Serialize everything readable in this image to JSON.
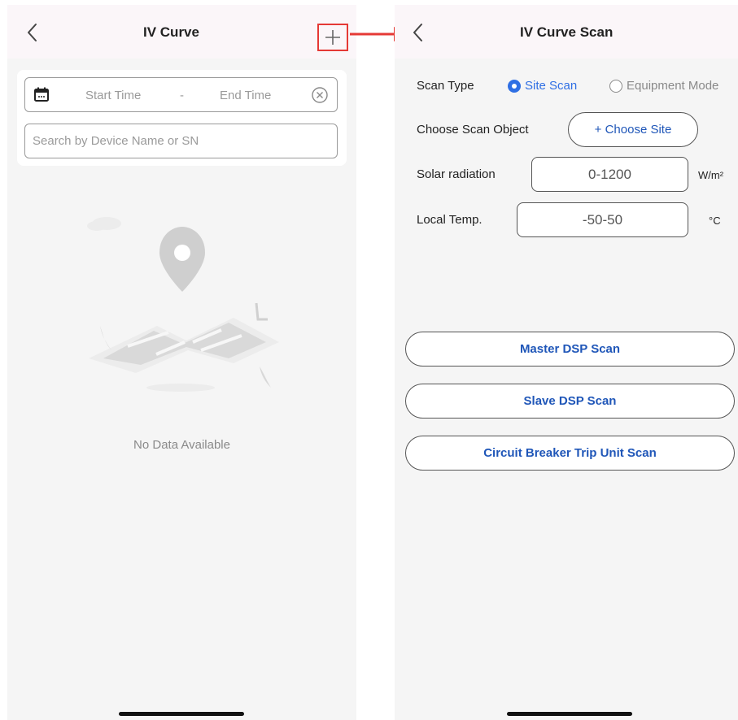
{
  "left": {
    "title": "IV Curve",
    "plus_label": "+",
    "start_time": "Start Time",
    "separator": "-",
    "end_time": "End Time",
    "search_placeholder": "Search by Device Name or SN",
    "empty_text": "No Data Available"
  },
  "right": {
    "title": "IV Curve Scan",
    "scan_type_label": "Scan Type",
    "scan_types": [
      {
        "label": "Site Scan",
        "selected": true
      },
      {
        "label": "Equipment Mode",
        "selected": false
      }
    ],
    "choose_object_label": "Choose Scan Object",
    "choose_site_button": "+ Choose Site",
    "solar_label": "Solar radiation",
    "solar_value": "0-1200",
    "solar_unit": "W/m²",
    "temp_label": "Local Temp.",
    "temp_value": "-50-50",
    "temp_unit": "°C",
    "buttons": [
      "Master DSP Scan",
      "Slave DSP Scan",
      "Circuit Breaker Trip Unit Scan"
    ]
  },
  "colors": {
    "accent_blue": "#2f6fe4",
    "button_text_blue": "#1f56b8",
    "highlight_red": "#e53935",
    "header_bg": "#fbf6f9",
    "screen_bg": "#f5f5f5"
  },
  "icons": [
    "back-icon",
    "plus-icon",
    "calendar-icon",
    "clear-icon",
    "map-pin-icon",
    "arrow-right-icon"
  ]
}
